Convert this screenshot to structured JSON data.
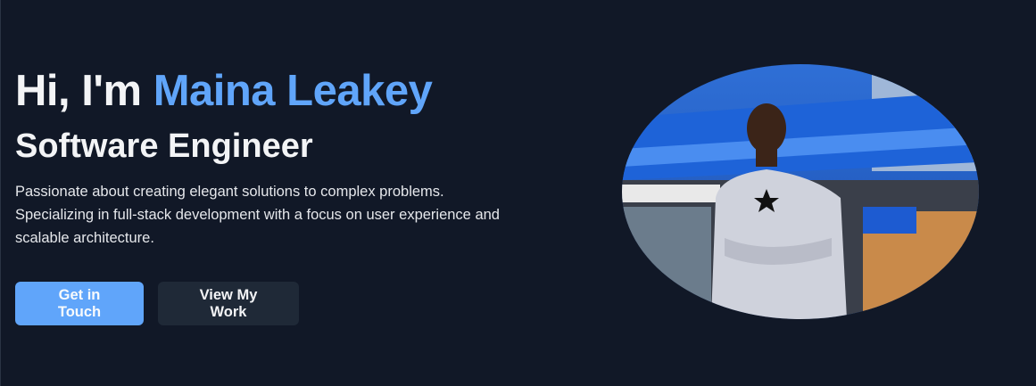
{
  "hero": {
    "greeting": "Hi, I'm ",
    "name": "Maina Leakey",
    "title": "Software Engineer",
    "description": "Passionate about creating elegant solutions to complex problems. Specializing in full-stack development with a focus on user experience and scalable architecture.",
    "primary_button": "Get in Touch",
    "secondary_button": "View My Work"
  },
  "photo": {
    "shape": "ellipse",
    "subject": "profile-photo"
  },
  "colors": {
    "background": "#111827",
    "accent": "#60a5fa",
    "secondary_button": "#1f2937"
  }
}
